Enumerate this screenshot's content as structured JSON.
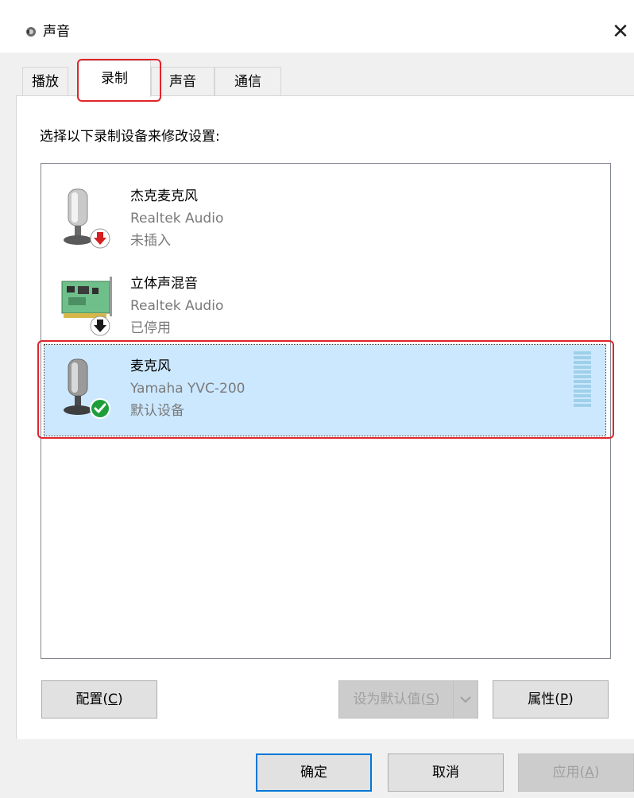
{
  "window": {
    "title": "声音",
    "close_glyph": "✕"
  },
  "tabs": [
    {
      "label": "播放"
    },
    {
      "label": "录制"
    },
    {
      "label": "声音"
    },
    {
      "label": "通信"
    }
  ],
  "instruction": "选择以下录制设备来修改设置:",
  "devices": [
    {
      "name": "杰克麦克风",
      "driver": "Realtek Audio",
      "status": "未插入",
      "icon": "microphone-icon",
      "badge": "red-down-arrow-badge"
    },
    {
      "name": "立体声混音",
      "driver": "Realtek Audio",
      "status": "已停用",
      "icon": "sound-card-icon",
      "badge": "black-down-arrow-badge"
    },
    {
      "name": "麦克风",
      "driver": "Yamaha YVC-200",
      "status": "默认设备",
      "icon": "microphone-icon",
      "badge": "green-check-badge",
      "selected": true
    }
  ],
  "buttons": {
    "configure": {
      "label": "配置(C)",
      "mnemonic": "C"
    },
    "set_default": {
      "label": "设为默认值(S)",
      "mnemonic": "S",
      "enabled": false
    },
    "properties": {
      "label": "属性(P)",
      "mnemonic": "P"
    },
    "ok": {
      "label": "确定"
    },
    "cancel": {
      "label": "取消"
    },
    "apply": {
      "label": "应用(A)",
      "mnemonic": "A",
      "enabled": false
    }
  },
  "colors": {
    "selection_bg": "#cce8ff",
    "annotation_red": "#e0252b",
    "primary_border": "#0078d7",
    "default_check_green": "#1e9e3a"
  }
}
